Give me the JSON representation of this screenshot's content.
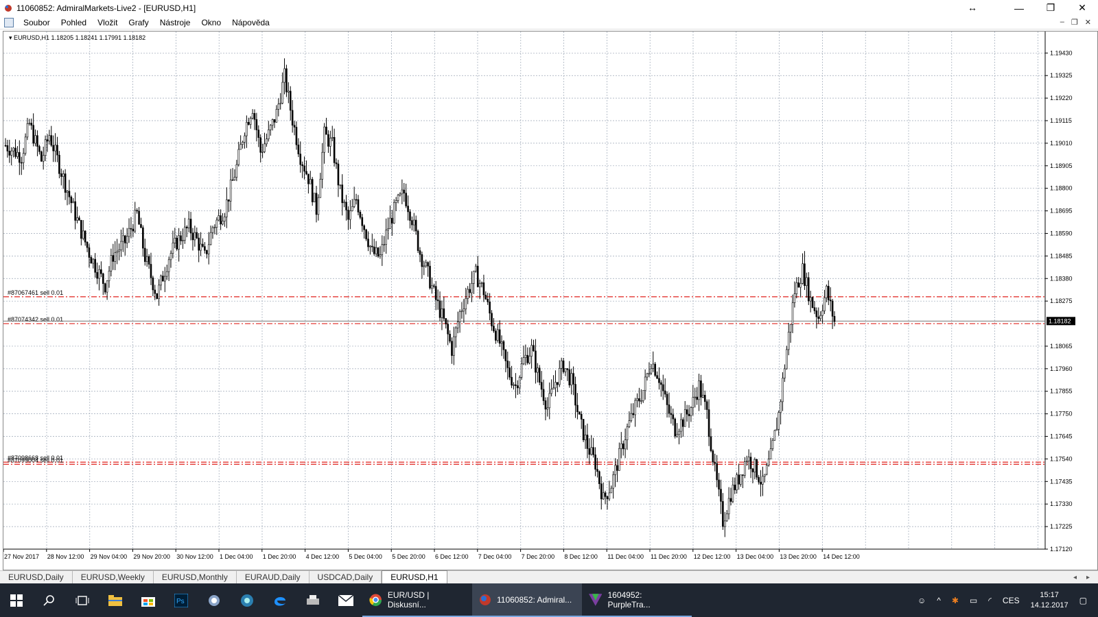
{
  "window": {
    "title": "11060852: AdmiralMarkets-Live2 - [EURUSD,H1]"
  },
  "menu": [
    "Soubor",
    "Pohled",
    "Vložit",
    "Grafy",
    "Nástroje",
    "Okno",
    "Nápověda"
  ],
  "chart_info": "EURUSD,H1  1.18205 1.18241 1.17991 1.18182",
  "chart_data": {
    "type": "candlestick",
    "symbol": "EURUSD",
    "timeframe": "H1",
    "ylim": [
      1.1712,
      1.1953
    ],
    "yticks": [
      "1.19430",
      "1.19325",
      "1.19220",
      "1.19115",
      "1.19010",
      "1.18905",
      "1.18800",
      "1.18695",
      "1.18590",
      "1.18485",
      "1.18380",
      "1.18275",
      "1.18065",
      "1.17960",
      "1.17855",
      "1.17750",
      "1.17645",
      "1.17540",
      "1.17435",
      "1.17330",
      "1.17225",
      "1.17120"
    ],
    "current_price": "1.18182",
    "current_price_value": 1.18182,
    "xticks": [
      "27 Nov 2017",
      "28 Nov 12:00",
      "29 Nov 04:00",
      "29 Nov 20:00",
      "30 Nov 12:00",
      "1 Dec 04:00",
      "1 Dec 20:00",
      "4 Dec 12:00",
      "5 Dec 04:00",
      "5 Dec 20:00",
      "6 Dec 12:00",
      "7 Dec 04:00",
      "7 Dec 20:00",
      "8 Dec 12:00",
      "11 Dec 04:00",
      "11 Dec 20:00",
      "12 Dec 12:00",
      "13 Dec 04:00",
      "13 Dec 20:00",
      "14 Dec 12:00"
    ],
    "orders": [
      {
        "label": "#87067461 sell 0.01",
        "price": 1.18295
      },
      {
        "label": "#87074342 sell 0.01",
        "price": 1.1817
      },
      {
        "label": "#87098668 sell 0.01",
        "price": 1.17525
      },
      {
        "label": "#87099004 sell 0.01",
        "price": 1.17515
      }
    ],
    "price_path": [
      [
        0,
        1.19
      ],
      [
        8,
        1.1895
      ],
      [
        12,
        1.191
      ],
      [
        18,
        1.1893
      ],
      [
        22,
        1.1905
      ],
      [
        30,
        1.1882
      ],
      [
        36,
        1.1865
      ],
      [
        42,
        1.185
      ],
      [
        46,
        1.1842
      ],
      [
        50,
        1.1835
      ],
      [
        54,
        1.1849
      ],
      [
        60,
        1.1855
      ],
      [
        66,
        1.1868
      ],
      [
        70,
        1.1848
      ],
      [
        76,
        1.183
      ],
      [
        82,
        1.1848
      ],
      [
        86,
        1.1855
      ],
      [
        92,
        1.1862
      ],
      [
        96,
        1.1856
      ],
      [
        100,
        1.1848
      ],
      [
        104,
        1.1862
      ],
      [
        110,
        1.187
      ],
      [
        116,
        1.189
      ],
      [
        120,
        1.1908
      ],
      [
        124,
        1.1918
      ],
      [
        128,
        1.1897
      ],
      [
        132,
        1.1905
      ],
      [
        136,
        1.1915
      ],
      [
        140,
        1.1932
      ],
      [
        144,
        1.1912
      ],
      [
        148,
        1.1895
      ],
      [
        152,
        1.1885
      ],
      [
        156,
        1.187
      ],
      [
        160,
        1.1905
      ],
      [
        164,
        1.19
      ],
      [
        168,
        1.1878
      ],
      [
        172,
        1.1865
      ],
      [
        176,
        1.1875
      ],
      [
        180,
        1.1862
      ],
      [
        184,
        1.185
      ],
      [
        188,
        1.1848
      ],
      [
        192,
        1.1862
      ],
      [
        196,
        1.1872
      ],
      [
        200,
        1.1878
      ],
      [
        204,
        1.1866
      ],
      [
        208,
        1.185
      ],
      [
        212,
        1.184
      ],
      [
        216,
        1.1828
      ],
      [
        220,
        1.1818
      ],
      [
        224,
        1.1805
      ],
      [
        228,
        1.1822
      ],
      [
        232,
        1.1832
      ],
      [
        236,
        1.184
      ],
      [
        240,
        1.1832
      ],
      [
        244,
        1.1818
      ],
      [
        248,
        1.1808
      ],
      [
        252,
        1.1795
      ],
      [
        256,
        1.1788
      ],
      [
        260,
        1.18
      ],
      [
        264,
        1.1805
      ],
      [
        268,
        1.179
      ],
      [
        272,
        1.1778
      ],
      [
        276,
        1.179
      ],
      [
        280,
        1.1798
      ],
      [
        284,
        1.179
      ],
      [
        288,
        1.1772
      ],
      [
        292,
        1.176
      ],
      [
        296,
        1.1752
      ],
      [
        300,
        1.1735
      ],
      [
        304,
        1.1742
      ],
      [
        308,
        1.1755
      ],
      [
        312,
        1.1768
      ],
      [
        316,
        1.1778
      ],
      [
        320,
        1.1786
      ],
      [
        324,
        1.18
      ],
      [
        328,
        1.1792
      ],
      [
        332,
        1.1778
      ],
      [
        336,
        1.1768
      ],
      [
        340,
        1.1772
      ],
      [
        344,
        1.1778
      ],
      [
        348,
        1.1788
      ],
      [
        352,
        1.1775
      ],
      [
        356,
        1.1748
      ],
      [
        360,
        1.1725
      ],
      [
        364,
        1.1738
      ],
      [
        368,
        1.1745
      ],
      [
        372,
        1.1755
      ],
      [
        376,
        1.175
      ],
      [
        380,
        1.1742
      ],
      [
        384,
        1.1755
      ],
      [
        388,
        1.1775
      ],
      [
        392,
        1.1805
      ],
      [
        396,
        1.1832
      ],
      [
        400,
        1.1842
      ],
      [
        404,
        1.1828
      ],
      [
        408,
        1.182
      ],
      [
        412,
        1.1832
      ],
      [
        416,
        1.1818
      ]
    ]
  },
  "tabs": [
    "EURUSD,Daily",
    "EURUSD,Weekly",
    "EURUSD,Monthly",
    "EURAUD,Daily",
    "USDCAD,Daily",
    "EURUSD,H1"
  ],
  "taskbar": {
    "apps": [
      {
        "label": "EUR/USD | Diskusní...",
        "color": "#e04a3a"
      },
      {
        "label": "11060852: Admiral...",
        "color": "#2a6fd6"
      },
      {
        "label": "1604952: PurpleTra...",
        "color": "#7a3fa0"
      }
    ],
    "lang": "CES",
    "time": "15:17",
    "date": "14.12.2017"
  }
}
